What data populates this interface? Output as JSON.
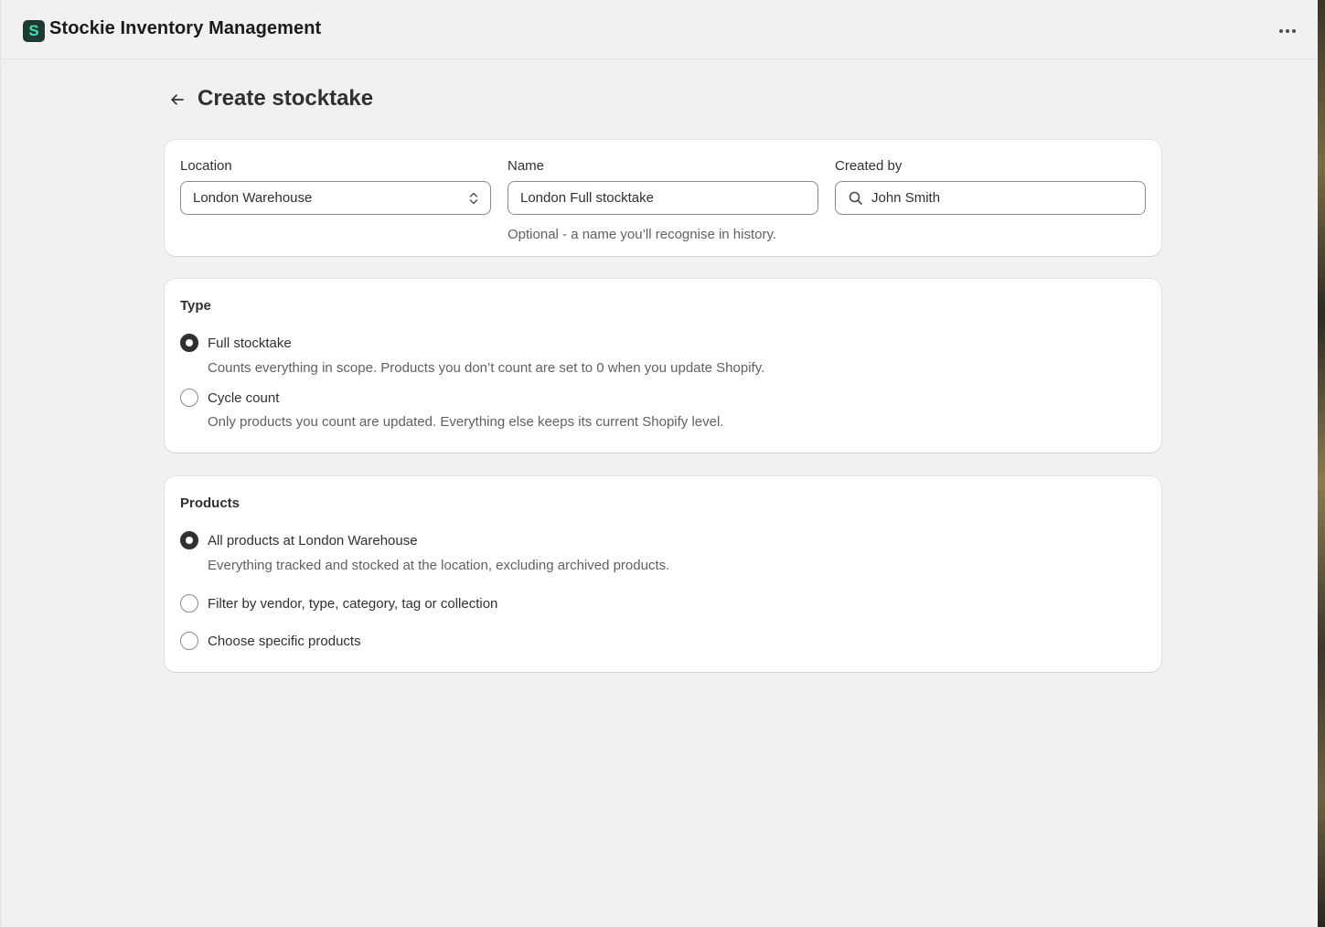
{
  "app": {
    "logo_letter": "S",
    "title": "Stockie Inventory Management"
  },
  "page": {
    "title": "Create stocktake"
  },
  "details": {
    "location": {
      "label": "Location",
      "value": "London Warehouse"
    },
    "name": {
      "label": "Name",
      "value": "London Full stocktake",
      "help": "Optional - a name you’ll recognise in history."
    },
    "created_by": {
      "label": "Created by",
      "value": "John Smith"
    }
  },
  "type": {
    "heading": "Type",
    "options": [
      {
        "label": "Full stocktake",
        "description": "Counts everything in scope. Products you don’t count are set to 0 when you update Shopify.",
        "selected": true
      },
      {
        "label": "Cycle count",
        "description": "Only products you count are updated. Everything else keeps its current Shopify level.",
        "selected": false
      }
    ]
  },
  "products": {
    "heading": "Products",
    "options": [
      {
        "label": "All products at London Warehouse",
        "description": "Everything tracked and stocked at the location, excluding archived products.",
        "selected": true
      },
      {
        "label": "Filter by vendor, type, category, tag or collection",
        "selected": false
      },
      {
        "label": "Choose specific products",
        "selected": false
      }
    ]
  },
  "colors": {
    "background": "#f1f1f1",
    "card": "#ffffff",
    "text": "#303030",
    "subdued_text": "#616161",
    "logo_bg": "#1f3a33",
    "logo_fg": "#3ee0b4"
  }
}
